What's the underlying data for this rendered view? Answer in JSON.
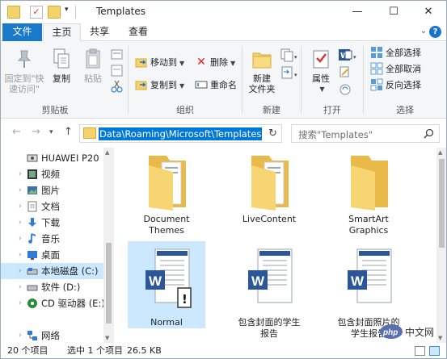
{
  "window": {
    "title": "Templates",
    "controls": {
      "minimize": "—",
      "maximize": "☐",
      "close": "✕"
    }
  },
  "ribbon_tabs": {
    "file": "文件",
    "home": "主页",
    "share": "共享",
    "view": "查看"
  },
  "ribbon": {
    "clipboard": {
      "group_label": "剪贴板",
      "pin_label_1": "固定到\"快",
      "pin_label_2": "速访问\"",
      "copy_label": "复制",
      "paste_label": "粘贴"
    },
    "organize": {
      "group_label": "组织",
      "move_to": "移动到",
      "copy_to": "复制到",
      "delete": "删除",
      "rename": "重命名"
    },
    "new": {
      "group_label": "新建",
      "new_folder_1": "新建",
      "new_folder_2": "文件夹"
    },
    "open": {
      "group_label": "打开",
      "properties": "属性"
    },
    "select": {
      "group_label": "选择",
      "select_all": "全部选择",
      "select_none": "全部取消",
      "invert": "反向选择"
    }
  },
  "address": {
    "path": "Data\\Roaming\\Microsoft\\Templates",
    "search_placeholder": "搜索\"Templates\""
  },
  "nav_pane": [
    {
      "label": "HUAWEI P20",
      "icon": "phone-icon",
      "expandable": false
    },
    {
      "label": "视频",
      "icon": "video-icon",
      "expandable": true
    },
    {
      "label": "图片",
      "icon": "pictures-icon",
      "expandable": true
    },
    {
      "label": "文档",
      "icon": "documents-icon",
      "expandable": true
    },
    {
      "label": "下载",
      "icon": "downloads-icon",
      "expandable": true
    },
    {
      "label": "音乐",
      "icon": "music-icon",
      "expandable": true
    },
    {
      "label": "桌面",
      "icon": "desktop-icon",
      "expandable": true
    },
    {
      "label": "本地磁盘 (C:)",
      "icon": "drive-icon",
      "expandable": true,
      "selected": true
    },
    {
      "label": "软件 (D:)",
      "icon": "drive-icon",
      "expandable": true
    },
    {
      "label": "CD 驱动器 (E:) I",
      "icon": "cd-drive-icon",
      "expandable": true
    },
    {
      "label": "网络",
      "icon": "network-icon",
      "expandable": true
    }
  ],
  "items": [
    {
      "name_1": "Document",
      "name_2": "Themes",
      "type": "folder"
    },
    {
      "name_1": "LiveContent",
      "name_2": "",
      "type": "folder"
    },
    {
      "name_1": "SmartArt",
      "name_2": "Graphics",
      "type": "folder"
    },
    {
      "name_1": "Normal",
      "name_2": "",
      "type": "word-template",
      "selected": true
    },
    {
      "name_1": "包含封面的学生",
      "name_2": "报告",
      "type": "word-doc"
    },
    {
      "name_1": "包含封面照片的",
      "name_2": "学生报告",
      "type": "word-doc"
    }
  ],
  "status": {
    "count": "20 个项目",
    "selection": "选中 1 个项目",
    "size": "26.5 KB"
  },
  "watermark": {
    "text": "php",
    "suffix": "中文网"
  },
  "colors": {
    "accent": "#1979ca",
    "selection": "#cce8ff",
    "folder": "#f5d36b",
    "word": "#2b579a"
  }
}
